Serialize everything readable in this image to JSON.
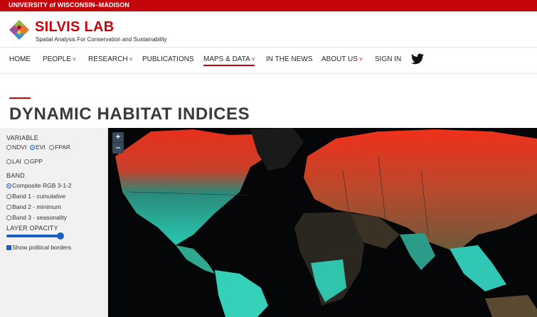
{
  "topbar": {
    "text": "UNIVERSITY of WISCONSIN–MADISON"
  },
  "header": {
    "brand": "SILVIS LAB",
    "tagline": "Spatial Analysis For Conservation and Sustainability"
  },
  "nav": {
    "items": [
      {
        "label": "HOME",
        "has_dropdown": false
      },
      {
        "label": "PEOPLE",
        "has_dropdown": true
      },
      {
        "label": "RESEARCH",
        "has_dropdown": true
      },
      {
        "label": "PUBLICATIONS",
        "has_dropdown": false
      },
      {
        "label": "MAPS & DATA",
        "has_dropdown": true,
        "active": true
      },
      {
        "label": "IN THE NEWS",
        "has_dropdown": false
      },
      {
        "label": "ABOUT US",
        "has_dropdown": true
      },
      {
        "label": "SIGN IN",
        "has_dropdown": false
      }
    ],
    "chevron": "˅",
    "social_icon": "twitter-icon"
  },
  "page": {
    "title": "DYNAMIC HABITAT INDICES"
  },
  "panel": {
    "variable_label": "VARIABLE",
    "variables": [
      {
        "label": "NDVI",
        "selected": false
      },
      {
        "label": "EVI",
        "selected": true
      },
      {
        "label": "FPAR",
        "selected": false
      },
      {
        "label": "LAI",
        "selected": false
      },
      {
        "label": "GPP",
        "selected": false
      }
    ],
    "band_label": "BAND",
    "bands": [
      {
        "label": "Composite RGB 3-1-2",
        "selected": true
      },
      {
        "label": "Band 1 - cumulative",
        "selected": false
      },
      {
        "label": "Band 2 - minimum",
        "selected": false
      },
      {
        "label": "Band 3 - seasonality",
        "selected": false
      }
    ],
    "opacity_label": "LAYER OPACITY",
    "opacity_value": 0.95,
    "borders_label": "Show political borders",
    "borders_checked": true
  },
  "map": {
    "zoom_in": "+",
    "zoom_out": "–"
  },
  "colors": {
    "accent": "#c5050c",
    "control": "#1a5fc8"
  }
}
